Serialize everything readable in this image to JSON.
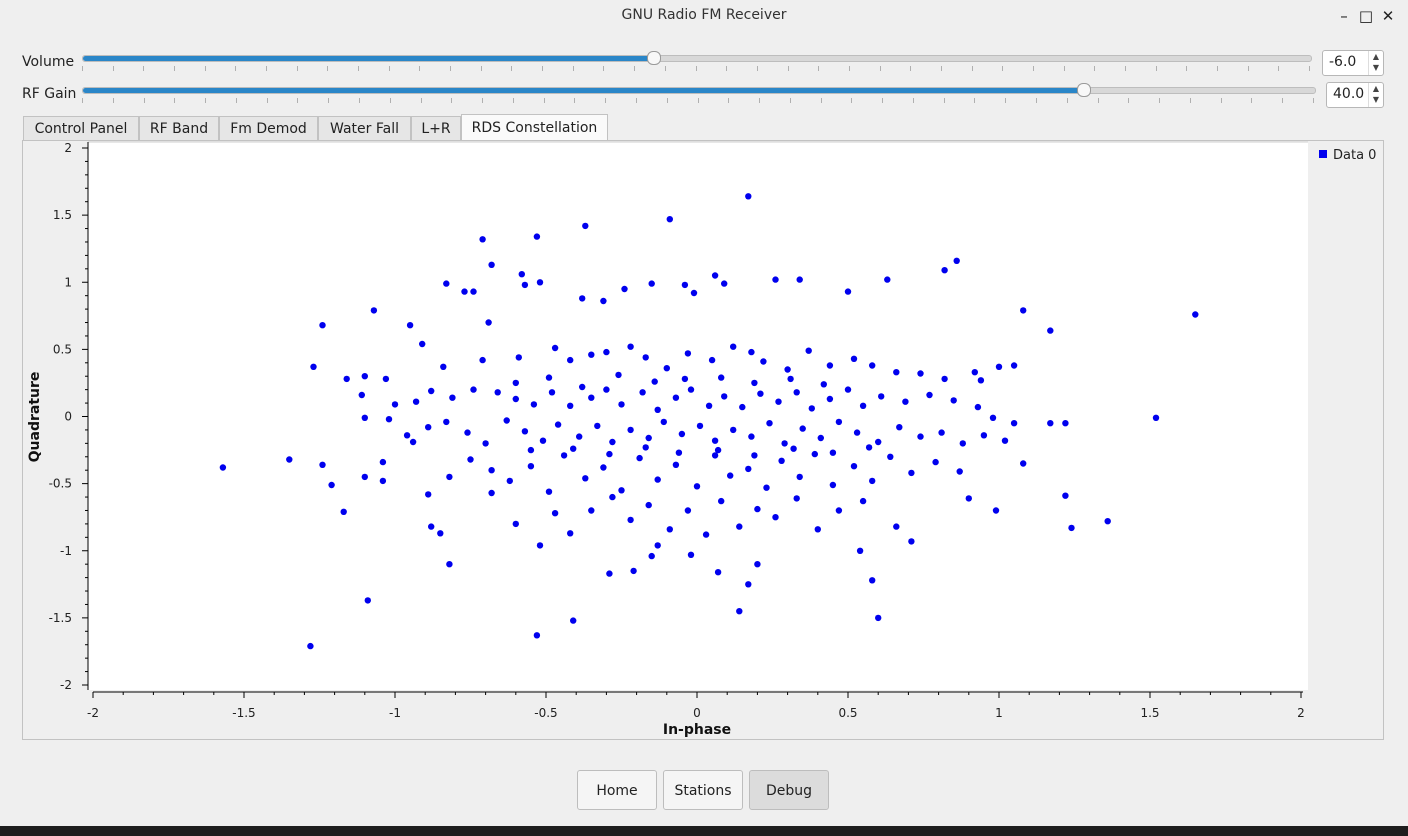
{
  "window": {
    "title": "GNU Radio FM Receiver",
    "minimize_icon": "minimize-icon",
    "maximize_icon": "maximize-icon",
    "close_icon": "close-icon"
  },
  "controls": {
    "volume": {
      "label": "Volume",
      "value": "-6.0",
      "fraction": 0.466
    },
    "rf_gain": {
      "label": "RF Gain",
      "value": "40.0",
      "fraction": 0.813
    }
  },
  "tabs": [
    {
      "label": "Control Panel"
    },
    {
      "label": "RF Band"
    },
    {
      "label": "Fm Demod"
    },
    {
      "label": "Water Fall"
    },
    {
      "label": "L+R"
    },
    {
      "label": "RDS Constellation",
      "active": true
    }
  ],
  "buttons": {
    "home": "Home",
    "stations": "Stations",
    "debug": "Debug"
  },
  "accent_color": "#2a86c8",
  "chart_data": {
    "type": "scatter",
    "xlabel": "In-phase",
    "ylabel": "Quadrature",
    "xlim": [
      -2,
      2
    ],
    "ylim": [
      -2,
      2
    ],
    "xticks": [
      "-2",
      "-1.5",
      "-1",
      "-0.5",
      "0",
      "0.5",
      "1",
      "1.5",
      "2"
    ],
    "yticks": [
      "2",
      "1.5",
      "1",
      "0.5",
      "0",
      "-0.5",
      "-1",
      "-1.5",
      "-2"
    ],
    "legend": {
      "label": "Data 0",
      "position": "top-right"
    },
    "color": "#0000ee",
    "grid": false,
    "series": [
      {
        "name": "Data 0",
        "points": [
          [
            0.17,
            1.64
          ],
          [
            -0.09,
            1.47
          ],
          [
            -0.37,
            1.42
          ],
          [
            -0.53,
            1.34
          ],
          [
            -0.71,
            1.32
          ],
          [
            -0.68,
            1.13
          ],
          [
            0.86,
            1.16
          ],
          [
            0.82,
            1.09
          ],
          [
            0.63,
            1.02
          ],
          [
            0.26,
            1.02
          ],
          [
            0.34,
            1.02
          ],
          [
            0.06,
            1.05
          ],
          [
            -0.58,
            1.06
          ],
          [
            -0.83,
            0.99
          ],
          [
            -0.77,
            0.93
          ],
          [
            -0.74,
            0.93
          ],
          [
            -0.52,
            1.0
          ],
          [
            -0.57,
            0.98
          ],
          [
            -0.24,
            0.95
          ],
          [
            -0.15,
            0.99
          ],
          [
            -0.04,
            0.98
          ],
          [
            -0.01,
            0.92
          ],
          [
            0.09,
            0.99
          ],
          [
            0.5,
            0.93
          ],
          [
            1.08,
            0.79
          ],
          [
            1.65,
            0.76
          ],
          [
            -1.07,
            0.79
          ],
          [
            -1.24,
            0.68
          ],
          [
            -0.95,
            0.68
          ],
          [
            -0.91,
            0.54
          ],
          [
            -0.69,
            0.7
          ],
          [
            -0.38,
            0.88
          ],
          [
            -0.31,
            0.86
          ],
          [
            1.17,
            0.64
          ],
          [
            -1.27,
            0.37
          ],
          [
            -1.16,
            0.28
          ],
          [
            -1.1,
            0.3
          ],
          [
            -1.03,
            0.28
          ],
          [
            -0.84,
            0.37
          ],
          [
            -0.71,
            0.42
          ],
          [
            -0.59,
            0.44
          ],
          [
            -0.47,
            0.51
          ],
          [
            -0.42,
            0.42
          ],
          [
            -0.35,
            0.46
          ],
          [
            -0.3,
            0.48
          ],
          [
            -0.22,
            0.52
          ],
          [
            -0.17,
            0.44
          ],
          [
            -0.1,
            0.36
          ],
          [
            -0.03,
            0.47
          ],
          [
            0.05,
            0.42
          ],
          [
            0.12,
            0.52
          ],
          [
            0.18,
            0.48
          ],
          [
            0.22,
            0.41
          ],
          [
            0.3,
            0.35
          ],
          [
            0.37,
            0.49
          ],
          [
            0.44,
            0.38
          ],
          [
            0.52,
            0.43
          ],
          [
            0.58,
            0.38
          ],
          [
            0.66,
            0.33
          ],
          [
            0.74,
            0.32
          ],
          [
            0.82,
            0.28
          ],
          [
            0.92,
            0.33
          ],
          [
            1.0,
            0.37
          ],
          [
            1.05,
            0.38
          ],
          [
            0.94,
            0.27
          ],
          [
            -1.11,
            0.16
          ],
          [
            -1.0,
            0.09
          ],
          [
            -0.93,
            0.11
          ],
          [
            -0.88,
            0.19
          ],
          [
            -0.81,
            0.14
          ],
          [
            -0.74,
            0.2
          ],
          [
            -0.66,
            0.18
          ],
          [
            -0.6,
            0.13
          ],
          [
            -0.54,
            0.09
          ],
          [
            -0.48,
            0.18
          ],
          [
            -0.42,
            0.08
          ],
          [
            -0.35,
            0.14
          ],
          [
            -0.3,
            0.2
          ],
          [
            -0.25,
            0.09
          ],
          [
            -0.18,
            0.18
          ],
          [
            -0.13,
            0.05
          ],
          [
            -0.07,
            0.14
          ],
          [
            -0.02,
            0.2
          ],
          [
            0.04,
            0.08
          ],
          [
            0.09,
            0.15
          ],
          [
            0.15,
            0.07
          ],
          [
            0.21,
            0.17
          ],
          [
            0.27,
            0.11
          ],
          [
            0.33,
            0.18
          ],
          [
            0.38,
            0.06
          ],
          [
            0.44,
            0.13
          ],
          [
            0.5,
            0.2
          ],
          [
            0.55,
            0.08
          ],
          [
            0.61,
            0.15
          ],
          [
            0.69,
            0.11
          ],
          [
            0.77,
            0.16
          ],
          [
            0.85,
            0.12
          ],
          [
            0.93,
            0.07
          ],
          [
            0.98,
            -0.01
          ],
          [
            1.05,
            -0.05
          ],
          [
            1.17,
            -0.05
          ],
          [
            1.22,
            -0.05
          ],
          [
            1.52,
            -0.01
          ],
          [
            -1.1,
            -0.01
          ],
          [
            -1.02,
            -0.02
          ],
          [
            -0.96,
            -0.14
          ],
          [
            -0.89,
            -0.08
          ],
          [
            -0.83,
            -0.04
          ],
          [
            -0.76,
            -0.12
          ],
          [
            -0.7,
            -0.2
          ],
          [
            -0.63,
            -0.03
          ],
          [
            -0.57,
            -0.11
          ],
          [
            -0.51,
            -0.18
          ],
          [
            -0.46,
            -0.06
          ],
          [
            -0.39,
            -0.15
          ],
          [
            -0.33,
            -0.07
          ],
          [
            -0.28,
            -0.19
          ],
          [
            -0.22,
            -0.1
          ],
          [
            -0.16,
            -0.16
          ],
          [
            -0.11,
            -0.04
          ],
          [
            -0.05,
            -0.13
          ],
          [
            0.01,
            -0.07
          ],
          [
            0.06,
            -0.18
          ],
          [
            0.12,
            -0.1
          ],
          [
            0.18,
            -0.15
          ],
          [
            0.24,
            -0.05
          ],
          [
            0.29,
            -0.2
          ],
          [
            0.35,
            -0.09
          ],
          [
            0.41,
            -0.16
          ],
          [
            0.47,
            -0.04
          ],
          [
            0.53,
            -0.12
          ],
          [
            0.6,
            -0.19
          ],
          [
            0.67,
            -0.08
          ],
          [
            0.74,
            -0.15
          ],
          [
            0.81,
            -0.12
          ],
          [
            0.88,
            -0.2
          ],
          [
            0.95,
            -0.14
          ],
          [
            1.02,
            -0.18
          ],
          [
            1.08,
            -0.35
          ],
          [
            -1.57,
            -0.38
          ],
          [
            -1.35,
            -0.32
          ],
          [
            -1.24,
            -0.36
          ],
          [
            -1.21,
            -0.51
          ],
          [
            -1.17,
            -0.71
          ],
          [
            -1.1,
            -0.45
          ],
          [
            -1.04,
            -0.48
          ],
          [
            -1.04,
            -0.34
          ],
          [
            -0.94,
            -0.19
          ],
          [
            -0.89,
            -0.58
          ],
          [
            -0.88,
            -0.82
          ],
          [
            -0.82,
            -0.45
          ],
          [
            -0.75,
            -0.32
          ],
          [
            -0.68,
            -0.4
          ],
          [
            -0.62,
            -0.48
          ],
          [
            -0.55,
            -0.37
          ],
          [
            -0.49,
            -0.56
          ],
          [
            -0.44,
            -0.29
          ],
          [
            -0.37,
            -0.46
          ],
          [
            -0.31,
            -0.38
          ],
          [
            -0.25,
            -0.55
          ],
          [
            -0.19,
            -0.31
          ],
          [
            -0.13,
            -0.47
          ],
          [
            -0.07,
            -0.36
          ],
          [
            0.0,
            -0.52
          ],
          [
            0.06,
            -0.29
          ],
          [
            0.11,
            -0.44
          ],
          [
            0.17,
            -0.39
          ],
          [
            0.23,
            -0.53
          ],
          [
            0.28,
            -0.33
          ],
          [
            0.34,
            -0.45
          ],
          [
            0.39,
            -0.28
          ],
          [
            0.45,
            -0.51
          ],
          [
            0.52,
            -0.37
          ],
          [
            0.58,
            -0.48
          ],
          [
            0.64,
            -0.3
          ],
          [
            0.71,
            -0.42
          ],
          [
            0.79,
            -0.34
          ],
          [
            0.87,
            -0.41
          ],
          [
            0.9,
            -0.61
          ],
          [
            0.99,
            -0.7
          ],
          [
            1.22,
            -0.59
          ],
          [
            1.24,
            -0.83
          ],
          [
            1.36,
            -0.78
          ],
          [
            -0.82,
            -1.1
          ],
          [
            -0.85,
            -0.87
          ],
          [
            -0.68,
            -0.57
          ],
          [
            -0.6,
            -0.8
          ],
          [
            -0.52,
            -0.96
          ],
          [
            -0.47,
            -0.72
          ],
          [
            -0.42,
            -0.87
          ],
          [
            -0.35,
            -0.7
          ],
          [
            -0.28,
            -0.6
          ],
          [
            -0.22,
            -0.77
          ],
          [
            -0.16,
            -0.66
          ],
          [
            -0.09,
            -0.84
          ],
          [
            -0.03,
            -0.7
          ],
          [
            0.03,
            -0.88
          ],
          [
            0.08,
            -0.63
          ],
          [
            0.14,
            -0.82
          ],
          [
            0.2,
            -0.69
          ],
          [
            0.26,
            -0.75
          ],
          [
            0.33,
            -0.61
          ],
          [
            0.4,
            -0.84
          ],
          [
            0.47,
            -0.7
          ],
          [
            0.55,
            -0.63
          ],
          [
            0.66,
            -0.82
          ],
          [
            0.71,
            -0.93
          ],
          [
            0.54,
            -1.0
          ],
          [
            0.58,
            -1.22
          ],
          [
            0.6,
            -1.5
          ],
          [
            0.17,
            -1.25
          ],
          [
            0.2,
            -1.1
          ],
          [
            0.07,
            -1.16
          ],
          [
            -0.02,
            -1.03
          ],
          [
            -0.15,
            -1.04
          ],
          [
            -0.21,
            -1.15
          ],
          [
            -0.29,
            -1.17
          ],
          [
            -0.13,
            -0.96
          ],
          [
            0.14,
            -1.45
          ],
          [
            -0.41,
            -1.52
          ],
          [
            -0.53,
            -1.63
          ],
          [
            -1.09,
            -1.37
          ],
          [
            -1.28,
            -1.71
          ],
          [
            -0.38,
            0.22
          ],
          [
            -0.26,
            0.31
          ],
          [
            -0.14,
            0.26
          ],
          [
            -0.04,
            0.28
          ],
          [
            0.08,
            0.29
          ],
          [
            0.19,
            0.25
          ],
          [
            0.31,
            0.28
          ],
          [
            0.42,
            0.24
          ],
          [
            -0.49,
            0.29
          ],
          [
            -0.6,
            0.25
          ],
          [
            -0.41,
            -0.24
          ],
          [
            -0.29,
            -0.28
          ],
          [
            -0.17,
            -0.23
          ],
          [
            -0.06,
            -0.27
          ],
          [
            0.07,
            -0.25
          ],
          [
            0.19,
            -0.29
          ],
          [
            0.32,
            -0.24
          ],
          [
            0.45,
            -0.27
          ],
          [
            0.57,
            -0.23
          ],
          [
            -0.55,
            -0.25
          ]
        ]
      }
    ]
  }
}
